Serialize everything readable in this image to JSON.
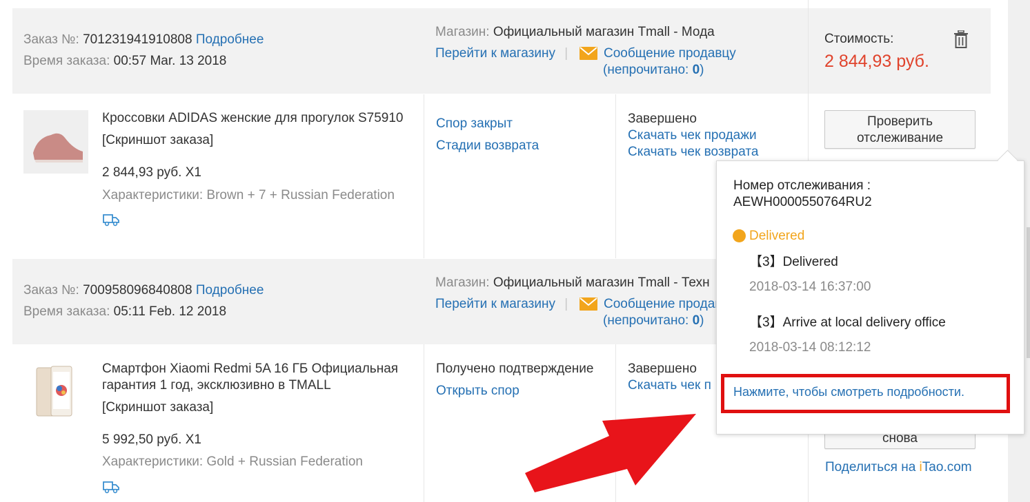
{
  "colors": {
    "link": "#2570b3",
    "price": "#e0432c",
    "header_bg": "#f2f2f2",
    "status_delivered": "#f2a51c",
    "highlight_box": "#e01010",
    "arrow": "#e8141a",
    "envelope": "#f2a51c"
  },
  "orders": [
    {
      "order_label": "Заказ №:",
      "order_number": "701231941910808",
      "details_link": "Подробнее",
      "time_label": "Время заказа:",
      "time_value": "00:57 Mar. 13 2018",
      "store_label": "Магазин:",
      "store_name": "Официальный магазин Tmall - Мода",
      "go_to_store": "Перейти к магазину",
      "separator": "|",
      "message_seller": "Сообщение продавцу",
      "unread_open": "(непрочитано: ",
      "unread_count": "0",
      "unread_close": ")",
      "cost_label": "Стоимость:",
      "cost_value": "2 844,93 руб.",
      "delete_icon": "trash-icon",
      "item": {
        "title": "Кроссовки ADIDAS женские для прогулок S75910",
        "screenshot_link": "[Скриншот заказа]",
        "price_qty": "2 844,93 руб. X1",
        "specs": "Характеристики: Brown + 7 + Russian Federation",
        "shipping_icon": "truck-icon",
        "dispute_status": "Спор закрыт",
        "return_stages": "Стадии возврата",
        "status": "Завершено",
        "download_receipt": "Скачать чек продажи",
        "download_return": "Скачать чек возврата",
        "track_button_line1": "Проверить",
        "track_button_line2": "отслеживание"
      }
    },
    {
      "order_label": "Заказ №:",
      "order_number": "700958096840808",
      "details_link": "Подробнее",
      "time_label": "Время заказа:",
      "time_value": "05:11 Feb. 12 2018",
      "store_label": "Магазин:",
      "store_name": "Официальный магазин Tmall - Техн",
      "go_to_store": "Перейти к магазину",
      "separator": "|",
      "message_seller": "Сообщение продав",
      "unread_open": "(непрочитано: ",
      "unread_count": "0",
      "unread_close": ")",
      "item": {
        "title_line1": "Смартфон Xiaomi Redmi 5A 16 ГБ Официальная",
        "title_line2": "гарантия 1 год, эксклюзивно в TMALL",
        "screenshot_link": "[Скриншот заказа]",
        "price_qty": "5 992,50 руб. X1",
        "specs": "Характеристики: Gold + Russian Federation",
        "shipping_icon": "truck-icon",
        "confirm_status": "Получено подтверждение",
        "open_dispute": "Открыть спор",
        "status": "Завершено",
        "download_receipt": "Скачать чек п",
        "buy_again_partial": "снова",
        "share_prefix": "Поделиться на ",
        "share_i": "i",
        "share_tao": "Tao",
        "share_com": ".com"
      }
    }
  ],
  "tracking_popup": {
    "number_label": "Номер отслеживания :",
    "number_value": "AEWH0000550764RU2",
    "current_status": "Delivered",
    "events": [
      {
        "title": "【3】Delivered",
        "time": "2018-03-14 16:37:00"
      },
      {
        "title": "【3】Arrive at local delivery office",
        "time": "2018-03-14 08:12:12"
      }
    ],
    "details_link": "Нажмите, чтобы смотреть подробности."
  }
}
